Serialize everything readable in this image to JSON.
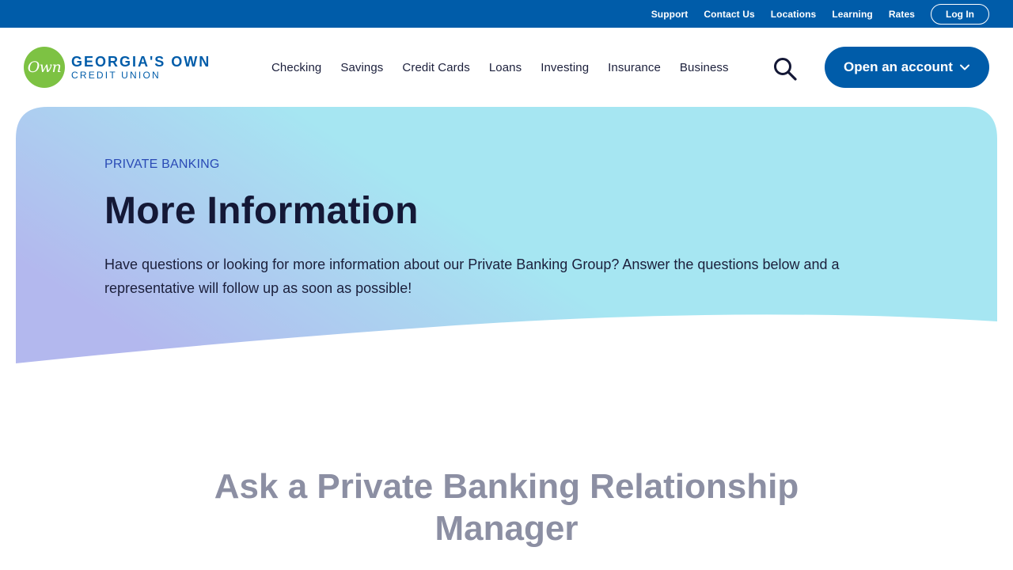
{
  "utility": {
    "links": [
      "Support",
      "Contact Us",
      "Locations",
      "Learning",
      "Rates"
    ],
    "login_label": "Log In"
  },
  "brand": {
    "badge": "Own",
    "line1": "GEORGIA'S OWN",
    "line2": "CREDIT UNION",
    "primary_color": "#005ca9",
    "badge_color": "#7dc243"
  },
  "nav": {
    "items": [
      "Checking",
      "Savings",
      "Credit Cards",
      "Loans",
      "Investing",
      "Insurance",
      "Business"
    ],
    "search_icon": "search-icon",
    "open_account_label": "Open an account"
  },
  "hero": {
    "eyebrow": "PRIVATE BANKING",
    "title": "More Information",
    "description": "Have questions or looking for more information about our Private Banking Group? Answer the questions below and a representative will follow up as soon as possible!",
    "gradient_start": "#b3b8ee",
    "gradient_end": "#a6e6f2"
  },
  "section": {
    "title": "Ask a Private Banking Relationship Manager"
  }
}
